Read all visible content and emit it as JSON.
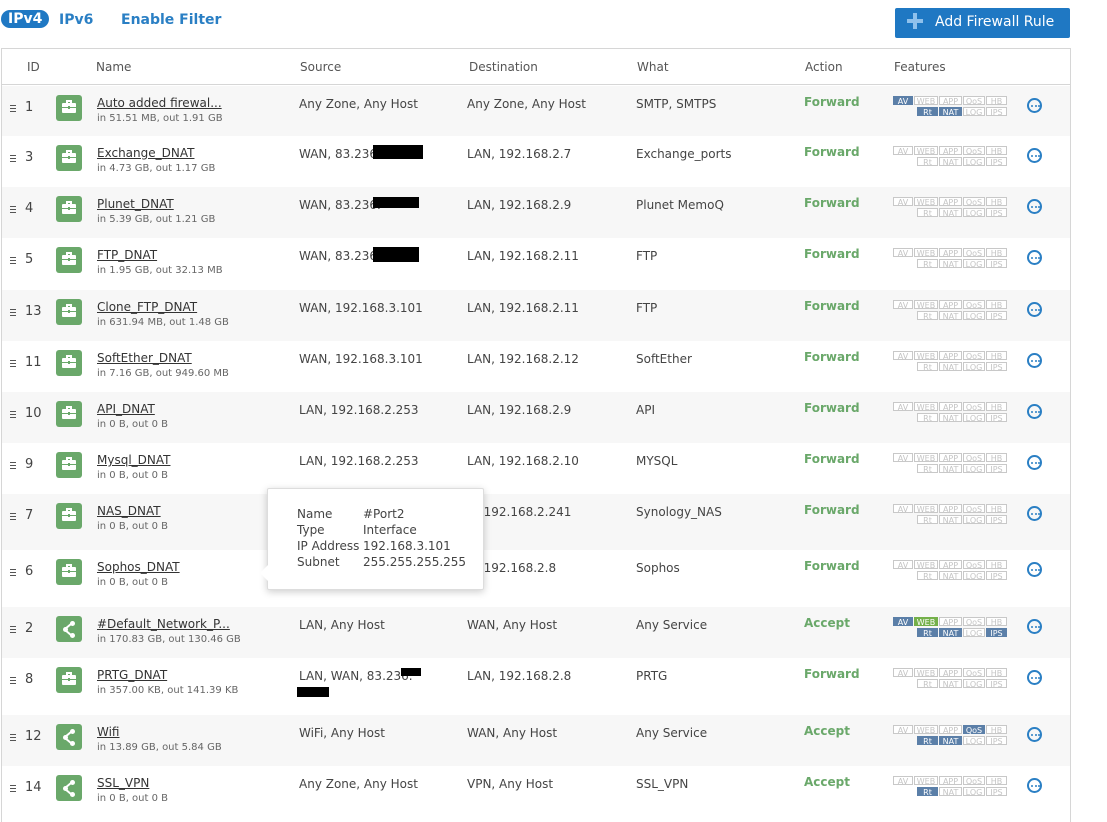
{
  "tabs": [
    {
      "label": "IPv4",
      "active": true
    },
    {
      "label": "IPv6",
      "active": false
    },
    {
      "label": "Enable Filter",
      "active": false
    }
  ],
  "add_button": {
    "label": "Add Firewall Rule",
    "icon": "plus-icon"
  },
  "columns": {
    "id": "ID",
    "name": "Name",
    "source": "Source",
    "destination": "Destination",
    "what": "What",
    "action": "Action",
    "features": "Features"
  },
  "feature_labels": [
    "AV",
    "WEB",
    "APP",
    "QoS",
    "HB",
    "Rt",
    "NAT",
    "LOG",
    "IPS"
  ],
  "colors": {
    "accent": "#1f78c3",
    "action_green": "#6aa86a",
    "feature_on": "#5b7fa8",
    "web_on": "#74b04a"
  },
  "rules": [
    {
      "id": "1",
      "name": "Auto added firewal...",
      "traffic": "in 51.51 MB, out 1.91 GB",
      "source": "Any Zone, Any Host",
      "source2": "",
      "destination": "Any Zone, Any Host",
      "what": "SMTP, SMTPS",
      "action": "Forward",
      "icon": "nat-rule-icon",
      "on": [
        "AV",
        "Rt",
        "NAT"
      ]
    },
    {
      "id": "3",
      "name": "Exchange_DNAT",
      "traffic": "in 4.73 GB, out 1.17 GB",
      "source": "WAN, 83.236.",
      "source2": "",
      "destination": "LAN, 192.168.2.7",
      "what": "Exchange_ports",
      "action": "Forward",
      "icon": "nat-rule-icon",
      "on": []
    },
    {
      "id": "4",
      "name": "Plunet_DNAT",
      "traffic": "in 5.39 GB, out 1.21 GB",
      "source": "WAN, 83.236.",
      "source2": "",
      "destination": "LAN, 192.168.2.9",
      "what": "Plunet MemoQ",
      "action": "Forward",
      "icon": "nat-rule-icon",
      "on": []
    },
    {
      "id": "5",
      "name": "FTP_DNAT",
      "traffic": "in 1.95 GB, out 32.13 MB",
      "source": "WAN, 83.236.",
      "source2": "",
      "destination": "LAN, 192.168.2.11",
      "what": "FTP",
      "action": "Forward",
      "icon": "nat-rule-icon",
      "on": []
    },
    {
      "id": "13",
      "name": "Clone_FTP_DNAT",
      "traffic": "in 631.94 MB, out 1.48 GB",
      "source": "WAN, 192.168.3.101",
      "source2": "",
      "destination": "LAN, 192.168.2.11",
      "what": "FTP",
      "action": "Forward",
      "icon": "nat-rule-icon",
      "on": []
    },
    {
      "id": "11",
      "name": "SoftEther_DNAT",
      "traffic": "in 7.16 GB, out 949.60 MB",
      "source": "WAN, 192.168.3.101",
      "source2": "",
      "destination": "LAN, 192.168.2.12",
      "what": "SoftEther",
      "action": "Forward",
      "icon": "nat-rule-icon",
      "on": []
    },
    {
      "id": "10",
      "name": "API_DNAT",
      "traffic": "in 0 B, out 0 B",
      "source": "LAN, 192.168.2.253",
      "source2": "",
      "destination": "LAN, 192.168.2.9",
      "what": "API",
      "action": "Forward",
      "icon": "nat-rule-icon",
      "on": []
    },
    {
      "id": "9",
      "name": "Mysql_DNAT",
      "traffic": "in 0 B, out 0 B",
      "source": "LAN, 192.168.2.253",
      "source2": "",
      "destination": "LAN, 192.168.2.10",
      "what": "MYSQL",
      "action": "Forward",
      "icon": "nat-rule-icon",
      "on": []
    },
    {
      "id": "7",
      "name": "NAS_DNAT",
      "traffic": "in 0 B, out 0 B",
      "source": "",
      "source2": "",
      "destination": "N, 192.168.2.241",
      "what": "Synology_NAS",
      "action": "Forward",
      "icon": "nat-rule-icon",
      "on": []
    },
    {
      "id": "6",
      "name": "Sophos_DNAT",
      "traffic": "in 0 B, out 0 B",
      "source": "",
      "source2": "",
      "destination": "N, 192.168.2.8",
      "what": "Sophos",
      "action": "Forward",
      "icon": "nat-rule-icon",
      "on": []
    },
    {
      "id": "2",
      "name": "#Default_Network_P...",
      "traffic": "in 170.83 GB, out 130.46 GB",
      "source": "LAN, Any Host",
      "source2": "",
      "destination": "WAN, Any Host",
      "what": "Any Service",
      "action": "Accept",
      "icon": "share-icon",
      "on": [
        "AV",
        "WEB",
        "Rt",
        "NAT",
        "IPS"
      ]
    },
    {
      "id": "8",
      "name": "PRTG_DNAT",
      "traffic": "in 357.00 KB, out 141.39 KB",
      "source": "LAN, WAN, 83.236.",
      "source2": "",
      "destination": "LAN, 192.168.2.8",
      "what": "PRTG",
      "action": "Forward",
      "icon": "nat-rule-icon",
      "on": []
    },
    {
      "id": "12",
      "name": "Wifi",
      "traffic": "in 13.89 GB, out 5.84 GB",
      "source": "WiFi, Any Host",
      "source2": "",
      "destination": "WAN, Any Host",
      "what": "Any Service",
      "action": "Accept",
      "icon": "share-icon",
      "on": [
        "QoS",
        "Rt",
        "NAT"
      ]
    },
    {
      "id": "14",
      "name": "SSL_VPN",
      "traffic": "in 0 B, out 0 B",
      "source": "Any Zone, Any Host",
      "source2": "",
      "destination": "VPN, Any Host",
      "what": "SSL_VPN",
      "action": "Accept",
      "icon": "share-icon",
      "on": [
        "Rt"
      ]
    }
  ],
  "tooltip": {
    "rows": [
      {
        "label": "Name",
        "value": "#Port2"
      },
      {
        "label": "Type",
        "value": "Interface"
      },
      {
        "label": "IP Address",
        "value": "192.168.3.101"
      },
      {
        "label": "Subnet",
        "value": "255.255.255.255"
      }
    ]
  }
}
